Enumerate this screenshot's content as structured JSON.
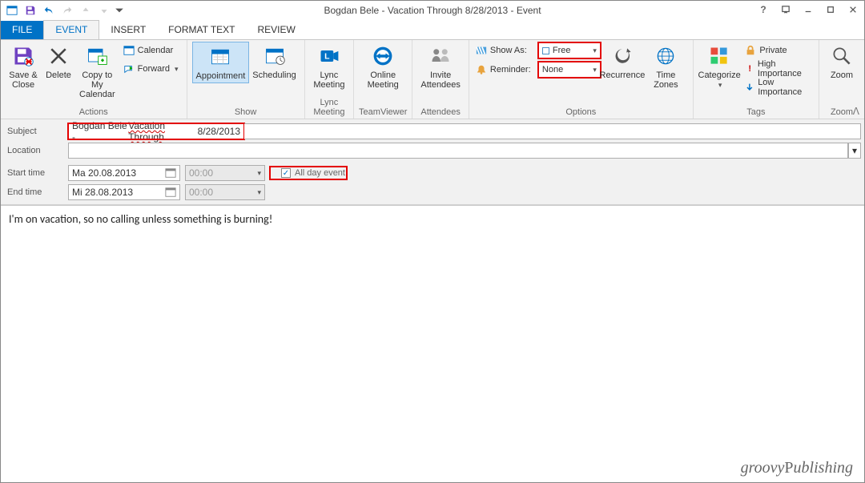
{
  "title": "Bogdan Bele - Vacation Through 8/28/2013 - Event",
  "tabs": {
    "file": "FILE",
    "event": "EVENT",
    "insert": "INSERT",
    "format": "FORMAT TEXT",
    "review": "REVIEW"
  },
  "ribbon": {
    "actions": {
      "label": "Actions",
      "save": "Save & Close",
      "delete": "Delete",
      "copy": "Copy to My Calendar",
      "calendar": "Calendar",
      "forward": "Forward"
    },
    "show": {
      "label": "Show",
      "appointment": "Appointment",
      "scheduling": "Scheduling"
    },
    "lync": {
      "label": "Lync Meeting",
      "btn": "Lync Meeting"
    },
    "tv": {
      "label": "TeamViewer",
      "btn": "Online Meeting"
    },
    "att": {
      "label": "Attendees",
      "btn": "Invite Attendees"
    },
    "options": {
      "label": "Options",
      "showAs": "Show As:",
      "showAsVal": "Free",
      "reminder": "Reminder:",
      "reminderVal": "None",
      "recurrence": "Recurrence",
      "tz": "Time Zones"
    },
    "tags": {
      "label": "Tags",
      "categorize": "Categorize",
      "private": "Private",
      "high": "High Importance",
      "low": "Low Importance"
    },
    "zoom": {
      "label": "Zoom",
      "btn": "Zoom"
    }
  },
  "form": {
    "subjectLabel": "Subject",
    "subjectValue_pre": "Bogdan Bele - ",
    "subjectValue_underlined": "Vacation Through",
    "subjectValue_post": " 8/28/2013",
    "locationLabel": "Location",
    "locationValue": "",
    "startLabel": "Start time",
    "startDate": "Ma 20.08.2013",
    "startTime": "00:00",
    "endLabel": "End time",
    "endDate": "Mi 28.08.2013",
    "endTime": "00:00",
    "allday": "All day event",
    "alldayChecked": "✓"
  },
  "body": "I'm on vacation, so no calling unless something is burning!",
  "watermark": "groovyPublishing"
}
